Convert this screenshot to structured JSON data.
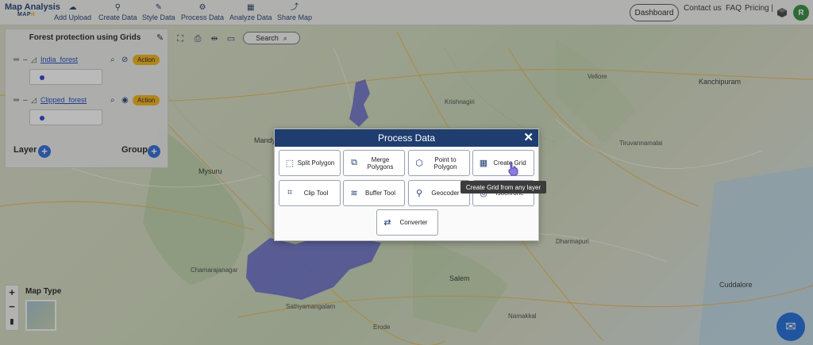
{
  "brand": {
    "title": "Map Analysis",
    "sub_prefix": "MAP",
    "sub_suffix": "it"
  },
  "nav": [
    {
      "label": "Add Upload",
      "icon": "cloud-upload-icon",
      "glyph": "☁"
    },
    {
      "label": "Create Data",
      "icon": "map-pin-icon",
      "glyph": "⚲"
    },
    {
      "label": "Style Data",
      "icon": "style-icon",
      "glyph": "✎"
    },
    {
      "label": "Process Data",
      "icon": "process-icon",
      "glyph": "⚙"
    },
    {
      "label": "Analyze Data",
      "icon": "analyze-icon",
      "glyph": "▦"
    },
    {
      "label": "Share Map",
      "icon": "share-icon",
      "glyph": "⤴"
    }
  ],
  "nav_right": {
    "dashboard": "Dashboard",
    "contact": "Contact us",
    "faq": "FAQ",
    "pricing": "Pricing |",
    "avatar": "R"
  },
  "panel": {
    "title": "Forest protection using Grids",
    "layers": [
      {
        "name": "India_forest",
        "action": "Action",
        "color": "#2a3fd6"
      },
      {
        "name": "Clipped_forest",
        "action": "Action",
        "color": "#2a3fd6"
      }
    ],
    "layer_label": "Layer",
    "group_label": "Group"
  },
  "search": {
    "label": "Search"
  },
  "map_type": {
    "label": "Map Type"
  },
  "zoom": {
    "in": "+",
    "out": "−"
  },
  "modal": {
    "title": "Process Data",
    "tools": [
      {
        "label": "Split Polygon",
        "icon": "split-polygon-icon",
        "glyph": "⬚"
      },
      {
        "label": "Merge Polygons",
        "icon": "merge-polygons-icon",
        "glyph": "⧉"
      },
      {
        "label": "Point to Polygon",
        "icon": "point-to-polygon-icon",
        "glyph": "⬡"
      },
      {
        "label": "Create Grid",
        "icon": "grid-icon",
        "glyph": "▦"
      },
      {
        "label": "Clip Tool",
        "icon": "crop-icon",
        "glyph": "⌗"
      },
      {
        "label": "Buffer Tool",
        "icon": "layers-icon",
        "glyph": "≋"
      },
      {
        "label": "Geocoder",
        "icon": "location-pin-icon",
        "glyph": "⚲"
      },
      {
        "label": "Isochrone",
        "icon": "isochrone-icon",
        "glyph": "◎"
      },
      {
        "label": "Converter",
        "icon": "converter-icon",
        "glyph": "⇄"
      }
    ],
    "tooltip": "Create Grid from any layer"
  },
  "map_labels": [
    "Mandya",
    "Mysuru",
    "Salem",
    "Kanchipuram",
    "Cuddalore",
    "Namakkal",
    "Tiruvannamalai",
    "Vellore",
    "Krishnagiri",
    "Dharmapuri",
    "Chamarajanagar",
    "Sathyamangalam",
    "Erode"
  ],
  "colors": {
    "brand": "#1f3d6e",
    "accent": "#f2b316",
    "forest": "#5f64c9",
    "avatar": "#2e8b3d",
    "chat": "#1e6ad8"
  }
}
